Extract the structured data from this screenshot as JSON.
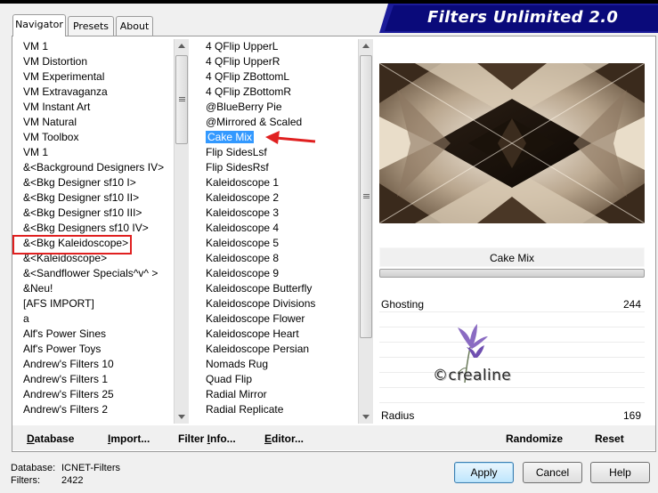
{
  "tabs": [
    {
      "label": "Navigator"
    },
    {
      "label": "Presets"
    },
    {
      "label": "About"
    }
  ],
  "logo": {
    "text": "Filters Unlimited 2.0"
  },
  "categories": [
    "VM 1",
    "VM Distortion",
    "VM Experimental",
    "VM Extravaganza",
    "VM Instant Art",
    "VM Natural",
    "VM Toolbox",
    "VM 1",
    "&<Background Designers IV>",
    "&<Bkg Designer sf10 I>",
    "&<Bkg Designer sf10 II>",
    "&<Bkg Designer sf10 III>",
    "&<Bkg Designers sf10 IV>",
    "&<Bkg Kaleidoscope>",
    "&<Kaleidoscope>",
    "&<Sandflower Specials^v^ >",
    "&Neu!",
    "[AFS IMPORT]",
    "a",
    "Alf's Power Sines",
    "Alf's Power Toys",
    "Andrew's Filters 10",
    "Andrew's Filters 1",
    "Andrew's Filters 25",
    "Andrew's Filters 2"
  ],
  "filters": [
    "4 QFlip UpperL",
    "4 QFlip UpperR",
    "4 QFlip ZBottomL",
    "4 QFlip ZBottomR",
    "@BlueBerry Pie",
    "@Mirrored & Scaled",
    "Cake Mix",
    "Flip SidesLsf",
    "Flip SidesRsf",
    "Kaleidoscope 1",
    "Kaleidoscope 2",
    "Kaleidoscope 3",
    "Kaleidoscope 4",
    "Kaleidoscope 5",
    "Kaleidoscope 8",
    "Kaleidoscope 9",
    "Kaleidoscope Butterfly",
    "Kaleidoscope Divisions",
    "Kaleidoscope Flower",
    "Kaleidoscope Heart",
    "Kaleidoscope Persian",
    "Nomads Rug",
    "Quad Flip",
    "Radial Mirror",
    "Radial Replicate"
  ],
  "selected_filter": "Cake Mix",
  "filter_name_label": "Cake Mix",
  "params": [
    {
      "label": "Ghosting",
      "value": "244"
    },
    {
      "label": "Radius",
      "value": "169"
    }
  ],
  "watermark": {
    "text": "©crealine"
  },
  "links": {
    "database": {
      "pre": "",
      "u": "D",
      "post": "atabase"
    },
    "import": {
      "pre": "",
      "u": "I",
      "post": "mport..."
    },
    "filter_info": {
      "pre": "Filter ",
      "u": "I",
      "post": "nfo..."
    },
    "editor": {
      "pre": "",
      "u": "E",
      "post": "ditor..."
    },
    "randomize": "Randomize",
    "reset": "Reset"
  },
  "status": {
    "database_label": "Database:",
    "database_value": "ICNET-Filters",
    "filters_label": "Filters:",
    "filters_value": "2422"
  },
  "buttons": {
    "apply": "Apply",
    "cancel": "Cancel",
    "help": "Help"
  },
  "colors": {
    "selection": "#3399ff",
    "highlight_box": "#e02020",
    "logo_bg": "#0a0a7a"
  }
}
